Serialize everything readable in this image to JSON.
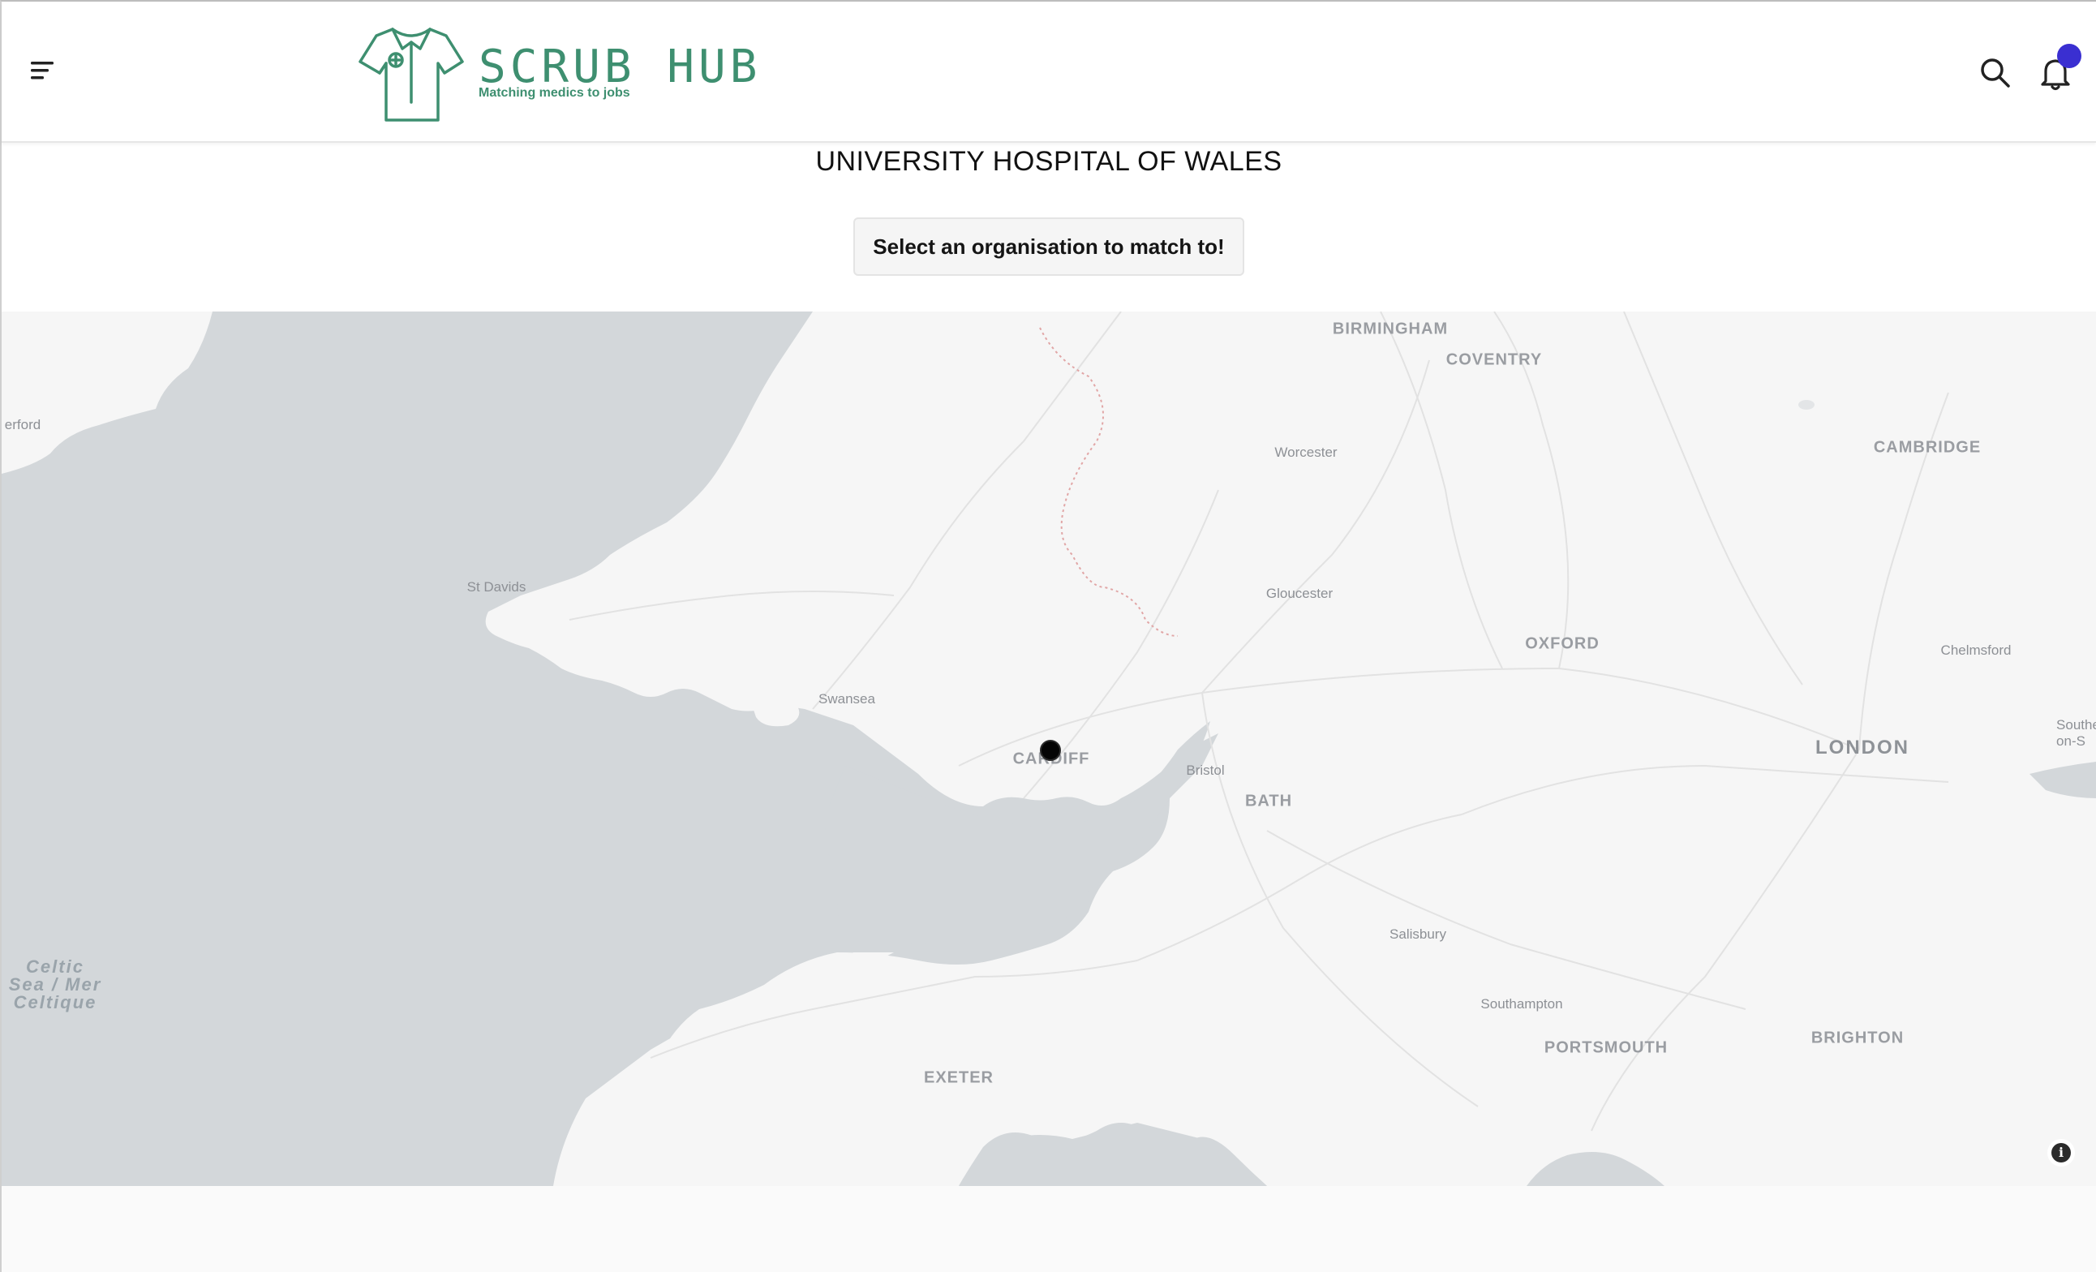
{
  "app": {
    "logo_title": "SCRUB HUB",
    "logo_tagline": "Matching medics to jobs",
    "brand_color": "#3e8f70",
    "notification_color": "#3a2fd1"
  },
  "header": {
    "menu_icon": "hamburger-menu-icon",
    "search_icon": "search-icon",
    "bell_icon": "bell-icon"
  },
  "main": {
    "org_title": "UNIVERSITY HOSPITAL OF WALES",
    "cta_label": "Select an organisation to match to!"
  },
  "map": {
    "labels": {
      "birmingham": "BIRMINGHAM",
      "coventry": "COVENTRY",
      "cambridge": "CAMBRIDGE",
      "worcester": "Worcester",
      "gloucester": "Gloucester",
      "oxford": "OXFORD",
      "chelmsford": "Chelmsford",
      "london": "LONDON",
      "southend": "Southe\non-S",
      "st_davids": "St Davids",
      "swansea": "Swansea",
      "cardiff": "CARDIFF",
      "bristol": "Bristol",
      "bath": "BATH",
      "salisbury": "Salisbury",
      "southampton": "Southampton",
      "portsmouth": "PORTSMOUTH",
      "brighton": "BRIGHTON",
      "exeter": "EXETER",
      "haverford": "erford",
      "celtic_sea": "Celtic Sea / Mer Celtique"
    },
    "attribution_icon": "info-icon",
    "land_color": "#f6f6f6",
    "water_color": "#d3d7da"
  }
}
